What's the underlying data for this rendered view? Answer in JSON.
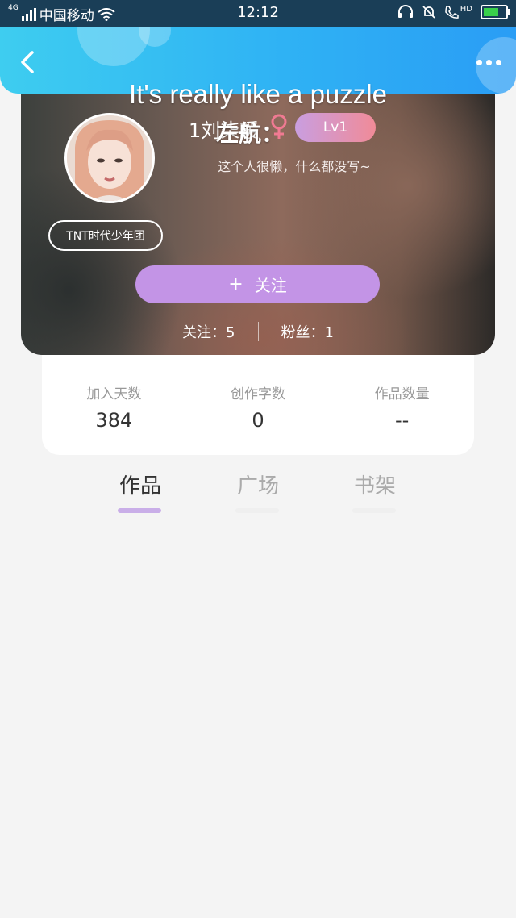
{
  "status_bar": {
    "network": "4G",
    "carrier": "中国移动",
    "time": "12:12",
    "hd_label": "HD",
    "battery_level": 0.7
  },
  "header": {
    "title": "It's really like a puzzle",
    "back_icon": "chevron-left-icon",
    "more_icon": "more-dots-icon"
  },
  "profile": {
    "nickname": "1刘柒瑗",
    "nickname_overlay": "左航：",
    "gender_symbol": "♀",
    "level": "Lv1",
    "bio": "这个人很懒，什么都没写~",
    "group_tag": "TNT时代少年团",
    "follow_button": {
      "icon": "+",
      "label": "关注"
    },
    "following": "关注：5",
    "followers": "粉丝：1"
  },
  "stats": [
    {
      "label": "加入天数",
      "value": "384"
    },
    {
      "label": "创作字数",
      "value": "0"
    },
    {
      "label": "作品数量",
      "value": "--"
    }
  ],
  "tabs": [
    {
      "label": "作品",
      "active": true
    },
    {
      "label": "广场",
      "active": false
    },
    {
      "label": "书架",
      "active": false
    }
  ],
  "colors": {
    "header_gradient_start": "#3ecdf0",
    "header_gradient_end": "#2a9df5",
    "follow_button": "#c394e6",
    "level_badge_start": "#c99ee0",
    "level_badge_end": "#f08b98",
    "tab_active_underline": "#c9aee8",
    "gender_icon": "#f07a92"
  }
}
